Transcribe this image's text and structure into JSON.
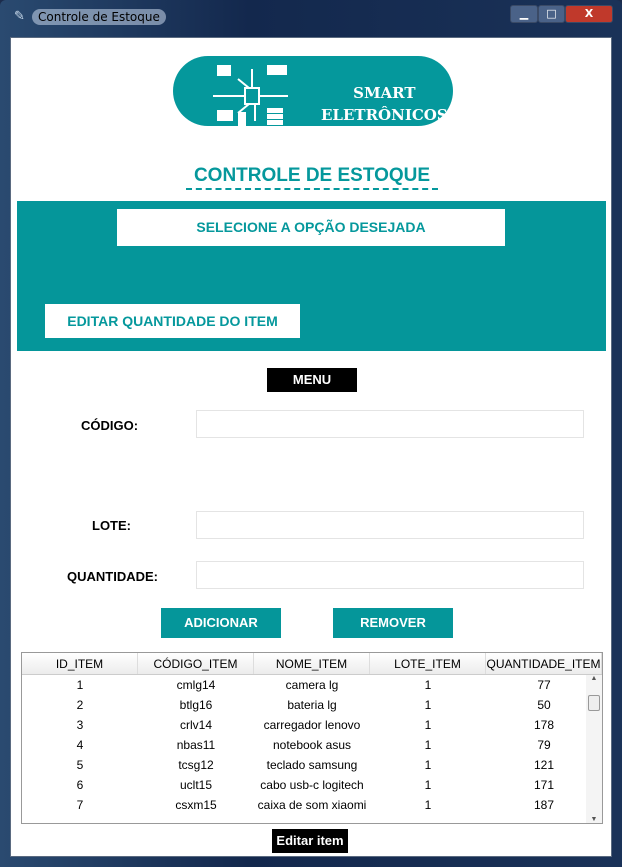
{
  "window": {
    "title": "Controle de Estoque",
    "minimize": "▁",
    "maximize": "□",
    "close": "X"
  },
  "logo": {
    "line1": "SMART",
    "line2": "ELETRÔNICOS"
  },
  "heading": "CONTROLE DE ESTOQUE",
  "band": {
    "select_label": "SELECIONE A OPÇÃO DESEJADA",
    "edit_button": "EDITAR QUANTIDADE DO ITEM"
  },
  "menu_button": "MENU",
  "form": {
    "codigo_label": "CÓDIGO:",
    "codigo_value": "",
    "lote_label": "LOTE:",
    "lote_value": "",
    "quantidade_label": "QUANTIDADE:",
    "quantidade_value": ""
  },
  "actions": {
    "add": "ADICIONAR",
    "remove": "REMOVER",
    "edit_item": "Editar item"
  },
  "table": {
    "columns": [
      "ID_ITEM",
      "CÓDIGO_ITEM",
      "NOME_ITEM",
      "LOTE_ITEM",
      "QUANTIDADE_ITEM"
    ],
    "rows": [
      [
        "1",
        "cmlg14",
        "camera lg",
        "1",
        "77"
      ],
      [
        "2",
        "btlg16",
        "bateria lg",
        "1",
        "50"
      ],
      [
        "3",
        "crlv14",
        "carregador lenovo",
        "1",
        "178"
      ],
      [
        "4",
        "nbas11",
        "notebook asus",
        "1",
        "79"
      ],
      [
        "5",
        "tcsg12",
        "teclado samsung",
        "1",
        "121"
      ],
      [
        "6",
        "uclt15",
        "cabo usb-c logitech",
        "1",
        "171"
      ],
      [
        "7",
        "csxm15",
        "caixa de som xiaomi",
        "1",
        "187"
      ]
    ]
  },
  "colors": {
    "accent": "#05969a"
  }
}
